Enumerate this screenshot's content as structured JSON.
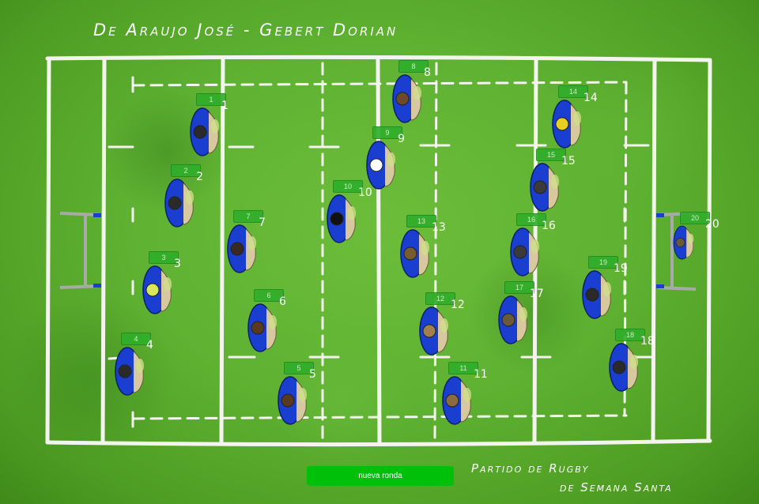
{
  "title_authors": "De Araujo José - Gebert Dorian",
  "caption": {
    "line1": "Partido de Rugby",
    "line2": "de Semana Santa"
  },
  "button": {
    "new_round": "nueva ronda"
  },
  "colors": {
    "jersey": "#1a3fd0",
    "field": "#5fb232",
    "button": "#00c00a",
    "tag": "#2fae2a"
  },
  "players": [
    {
      "num": "1",
      "tag": "1",
      "head": "#2a2a2a"
    },
    {
      "num": "2",
      "tag": "2",
      "head": "#2a2a2a"
    },
    {
      "num": "3",
      "tag": "3",
      "head": "#d8e85a"
    },
    {
      "num": "4",
      "tag": "4",
      "head": "#2a2a2a"
    },
    {
      "num": "5",
      "tag": "5",
      "head": "#5a3a1e"
    },
    {
      "num": "6",
      "tag": "6",
      "head": "#5a3a1e"
    },
    {
      "num": "7",
      "tag": "7",
      "head": "#3a2a1e"
    },
    {
      "num": "8",
      "tag": "8",
      "head": "#6a4a2a"
    },
    {
      "num": "9",
      "tag": "9",
      "head": "#ffffff"
    },
    {
      "num": "10",
      "tag": "10",
      "head": "#111111"
    },
    {
      "num": "11",
      "tag": "11",
      "head": "#8a6a40"
    },
    {
      "num": "12",
      "tag": "12",
      "head": "#a08050"
    },
    {
      "num": "13",
      "tag": "13",
      "head": "#7a5a30"
    },
    {
      "num": "14",
      "tag": "14",
      "head": "#e8d020"
    },
    {
      "num": "15",
      "tag": "15",
      "head": "#3a3a3a"
    },
    {
      "num": "16",
      "tag": "16",
      "head": "#3a3a3a"
    },
    {
      "num": "17",
      "tag": "17",
      "head": "#6a5a3a"
    },
    {
      "num": "18",
      "tag": "18",
      "head": "#2a2a2a"
    },
    {
      "num": "19",
      "tag": "19",
      "head": "#2a2a2a"
    },
    {
      "num": "20",
      "tag": "20",
      "head": "#6a5a3a"
    }
  ]
}
